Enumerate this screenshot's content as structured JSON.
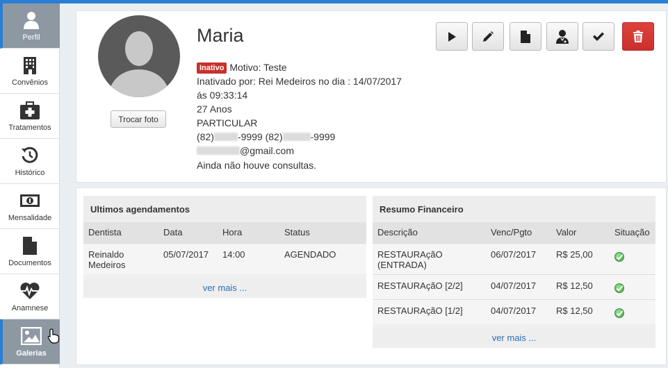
{
  "sidebar": {
    "items": [
      {
        "label": "Perfil",
        "icon": "user-icon"
      },
      {
        "label": "Convênios",
        "icon": "building-icon"
      },
      {
        "label": "Tratamentos",
        "icon": "medkit-icon"
      },
      {
        "label": "Histórico",
        "icon": "history-icon"
      },
      {
        "label": "Mensalidade",
        "icon": "money-icon"
      },
      {
        "label": "Documentos",
        "icon": "document-icon"
      },
      {
        "label": "Anamnese",
        "icon": "heartbeat-icon"
      },
      {
        "label": "Galerias",
        "icon": "image-icon"
      }
    ]
  },
  "profile": {
    "name": "Maria",
    "photo_button": "Trocar foto",
    "status_badge": "Inativo",
    "reason": "Motivo: Teste",
    "inactivated_by": "Inativado por: Rei Medeiros no dia : 14/07/2017",
    "inactivated_time": "ás 09:33:14",
    "age": "27 Anos",
    "plan": "PARTICULAR",
    "phone1_prefix": "(82)",
    "phone1_suffix": "-9999",
    "phone2_prefix": "(82)",
    "phone2_suffix": "-9999",
    "email_suffix": "@gmail.com",
    "consultations": "Ainda não houve consultas."
  },
  "actions": {
    "play": "play-icon",
    "edit": "pencil-icon",
    "document": "file-icon",
    "doctor": "doctor-icon",
    "confirm": "check-icon",
    "delete": "trash-icon"
  },
  "appointments": {
    "title": "Ultimos agendamentos",
    "columns": [
      "Dentista",
      "Data",
      "Hora",
      "Status"
    ],
    "rows": [
      {
        "dentist_line1": "Reinaldo",
        "dentist_line2": "Medeiros",
        "date": "05/07/2017",
        "time": "14:00",
        "status": "AGENDADO"
      }
    ],
    "more": "ver mais ..."
  },
  "finance": {
    "title": "Resumo Financeiro",
    "columns": [
      "Descrição",
      "Venc/Pgto",
      "Valor",
      "Situação"
    ],
    "rows": [
      {
        "desc_line1": "RESTAURAçãO",
        "desc_line2": "(ENTRADA)",
        "date": "06/07/2017",
        "value": "R$ 25,00",
        "status_icon": "check-circle-icon"
      },
      {
        "desc_line1": "RESTAURAçãO [2/2]",
        "desc_line2": "",
        "date": "04/07/2017",
        "value": "R$ 12,50",
        "status_icon": "check-circle-icon"
      },
      {
        "desc_line1": "RESTAURAçãO [1/2]",
        "desc_line2": "",
        "date": "04/07/2017",
        "value": "R$ 12,50",
        "status_icon": "check-circle-icon"
      }
    ],
    "more": "ver mais ..."
  },
  "colors": {
    "accent": "#2a7fd4",
    "danger": "#c9302c",
    "sidebar_active": "#8d98a3",
    "link": "#2a6fb2"
  }
}
